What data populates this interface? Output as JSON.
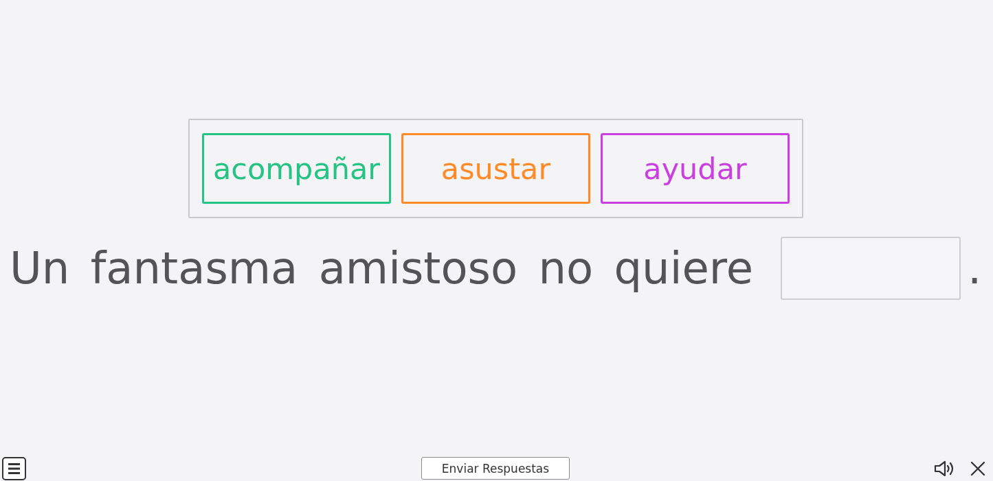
{
  "word_bank": {
    "words": [
      {
        "text": "acompañar",
        "color": "#25c485"
      },
      {
        "text": "asustar",
        "color": "#ff8a27"
      },
      {
        "text": "ayudar",
        "color": "#c93fdf"
      }
    ]
  },
  "sentence": {
    "parts": [
      {
        "kind": "text",
        "text": "Un fantasma amistoso no quiere"
      },
      {
        "kind": "blank"
      },
      {
        "kind": "text",
        "text": "."
      }
    ]
  },
  "bottom_bar": {
    "submit_button": "Enviar Respuestas"
  }
}
